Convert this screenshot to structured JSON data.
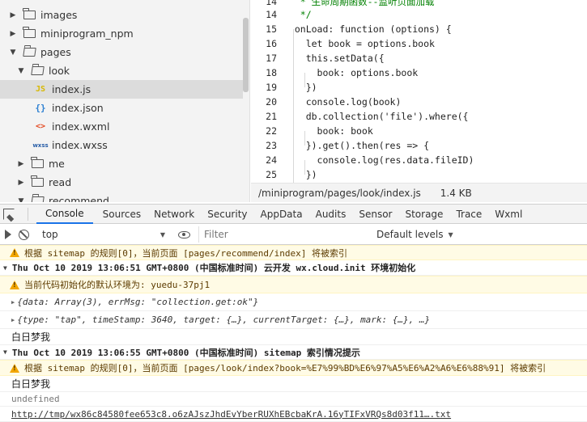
{
  "explorer": {
    "items": [
      {
        "label": "images",
        "kind": "folder",
        "expanded": false
      },
      {
        "label": "miniprogram_npm",
        "kind": "folder",
        "expanded": false
      },
      {
        "label": "pages",
        "kind": "folder",
        "expanded": true
      },
      {
        "label": "look",
        "kind": "folder",
        "expanded": true
      },
      {
        "label": "index.js",
        "kind": "js",
        "icon_text": "JS",
        "selected": true
      },
      {
        "label": "index.json",
        "kind": "json",
        "icon_text": "{}"
      },
      {
        "label": "index.wxml",
        "kind": "wxml",
        "icon_text": "<>"
      },
      {
        "label": "index.wxss",
        "kind": "wxss",
        "icon_text": "wxss"
      },
      {
        "label": "me",
        "kind": "folder",
        "expanded": false
      },
      {
        "label": "read",
        "kind": "folder",
        "expanded": false
      },
      {
        "label": "recommend",
        "kind": "folder",
        "expanded": true
      }
    ]
  },
  "editor": {
    "lines": [
      {
        "n": "14",
        "text": "   * 生命周期函数--监听页面加载"
      },
      {
        "n": "14",
        "text": "   */"
      },
      {
        "n": "15",
        "text": "  onLoad: function (options) {"
      },
      {
        "n": "16",
        "text": "    let book = options.book"
      },
      {
        "n": "17",
        "text": "    this.setData({"
      },
      {
        "n": "18",
        "text": "      book: options.book"
      },
      {
        "n": "19",
        "text": "    })"
      },
      {
        "n": "20",
        "text": "    console.log(book)"
      },
      {
        "n": "21",
        "text": "    db.collection('file').where({"
      },
      {
        "n": "22",
        "text": "      book: book"
      },
      {
        "n": "23",
        "text": "    }).get().then(res => {"
      },
      {
        "n": "24",
        "text": "      console.log(res.data.fileID)"
      },
      {
        "n": "25",
        "text": "    })"
      }
    ],
    "status_path": "/miniprogram/pages/look/index.js",
    "status_size": "1.4 KB"
  },
  "devtools": {
    "tabs": [
      "Console",
      "Sources",
      "Network",
      "Security",
      "AppData",
      "Audits",
      "Sensor",
      "Storage",
      "Trace",
      "Wxml"
    ],
    "active_tab": "Console",
    "context": "top",
    "filter_placeholder": "Filter",
    "levels": "Default levels"
  },
  "console": {
    "messages": [
      {
        "type": "warn",
        "text": "根据 sitemap 的规则[0]，当前页面 [pages/recommend/index] 将被索引"
      },
      {
        "type": "group",
        "text": "Thu Oct 10 2019 13:06:51 GMT+0800 (中国标准时间) 云开发 wx.cloud.init 环境初始化"
      },
      {
        "type": "warn",
        "text": "当前代码初始化的默认环境为: yuedu-37pj1"
      },
      {
        "type": "object",
        "text": "{data: Array(3), errMsg: \"collection.get:ok\"}"
      },
      {
        "type": "object",
        "text": "{type: \"tap\", timeStamp: 3640, target: {…}, currentTarget: {…}, mark: {…}, …}"
      },
      {
        "type": "log",
        "text": "白日梦我"
      },
      {
        "type": "group",
        "text": "Thu Oct 10 2019 13:06:55 GMT+0800 (中国标准时间) sitemap 索引情况提示"
      },
      {
        "type": "warn",
        "text": "根据 sitemap 的规则[0]，当前页面 [pages/look/index?book=%E7%99%BD%E6%97%A5%E6%A2%A6%E6%88%91] 将被索引"
      },
      {
        "type": "log",
        "text": "白日梦我"
      },
      {
        "type": "undefined",
        "text": "undefined"
      },
      {
        "type": "link",
        "text": "http://tmp/wx86c84580fee653c8.o6zAJszJhdEvYberRUXhEBcbaKrA.16yTIFxVRQs8d03f11….txt"
      }
    ]
  }
}
